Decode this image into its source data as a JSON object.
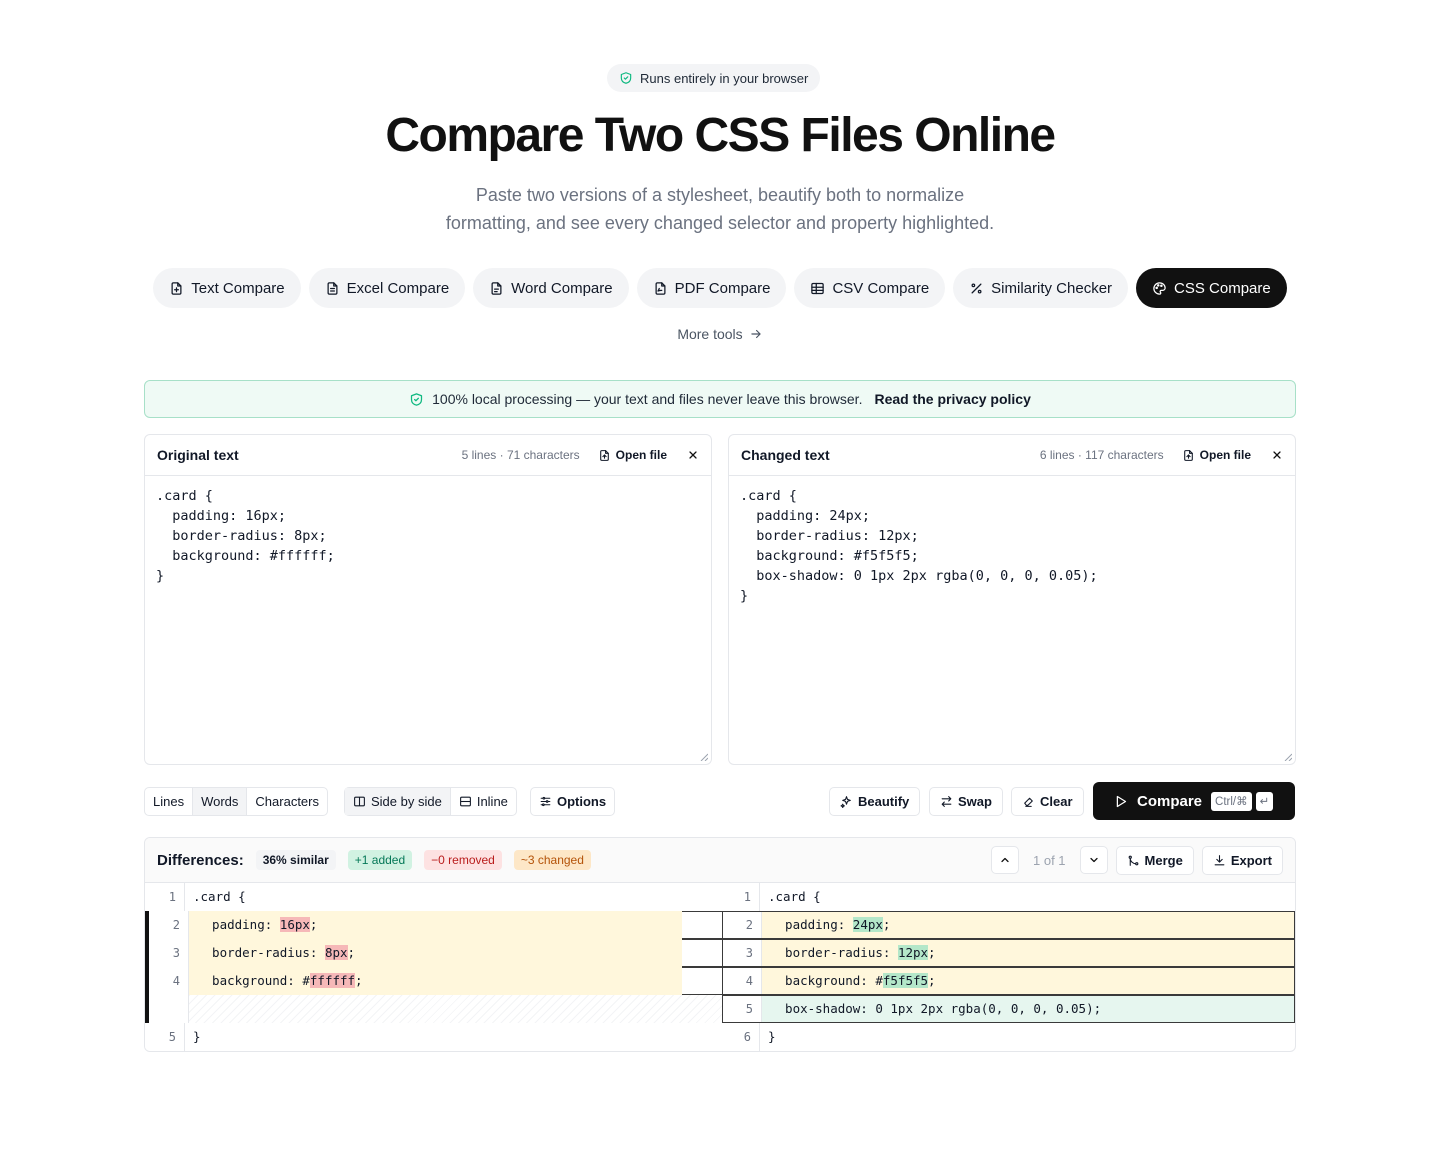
{
  "hero": {
    "badge": "Runs entirely in your browser",
    "title": "Compare Two CSS Files Online",
    "subtitle_line1": "Paste two versions of a stylesheet, beautify both to normalize",
    "subtitle_line2": "formatting, and see every changed selector and property highlighted."
  },
  "tools": [
    {
      "label": "Text Compare",
      "icon": "file-text-icon"
    },
    {
      "label": "Excel Compare",
      "icon": "spreadsheet-file-icon"
    },
    {
      "label": "Word Compare",
      "icon": "document-icon"
    },
    {
      "label": "PDF Compare",
      "icon": "pdf-file-icon"
    },
    {
      "label": "CSV Compare",
      "icon": "table-icon"
    },
    {
      "label": "Similarity Checker",
      "icon": "percent-icon"
    },
    {
      "label": "CSS Compare",
      "icon": "palette-icon",
      "active": true
    }
  ],
  "more_tools": "More tools",
  "privacy": {
    "text": "100% local processing — your text and files never leave this browser.",
    "link": "Read the privacy policy"
  },
  "editors": {
    "left": {
      "title": "Original text",
      "meta": "5 lines · 71 characters",
      "open": "Open file",
      "content": ".card {\n  padding: 16px;\n  border-radius: 8px;\n  background: #ffffff;\n}"
    },
    "right": {
      "title": "Changed text",
      "meta": "6 lines · 117 characters",
      "open": "Open file",
      "content": ".card {\n  padding: 24px;\n  border-radius: 12px;\n  background: #f5f5f5;\n  box-shadow: 0 1px 2px rgba(0, 0, 0, 0.05);\n}"
    }
  },
  "toolbar": {
    "granularity": [
      "Lines",
      "Words",
      "Characters"
    ],
    "view_side": "Side by side",
    "view_inline": "Inline",
    "options": "Options",
    "beautify": "Beautify",
    "swap": "Swap",
    "clear": "Clear",
    "compare": "Compare",
    "kbd_mod": "Ctrl/⌘",
    "kbd_enter": "↵"
  },
  "diff": {
    "title": "Differences:",
    "similar": "36% similar",
    "added": "+1 added",
    "removed": "−0 removed",
    "changed": "~3 changed",
    "counter": "1 of 1",
    "merge": "Merge",
    "export": "Export",
    "rows": [
      {
        "type": "same",
        "l_no": "1",
        "l_pre": ".card {",
        "l_hl": "",
        "l_post": "",
        "r_no": "1",
        "r_pre": ".card {",
        "r_hl": "",
        "r_post": ""
      },
      {
        "type": "changed",
        "l_no": "2",
        "l_pre": "  padding: ",
        "l_hl": "16px",
        "l_post": ";",
        "r_no": "2",
        "r_pre": "  padding: ",
        "r_hl": "24px",
        "r_post": ";"
      },
      {
        "type": "changed",
        "l_no": "3",
        "l_pre": "  border-radius: ",
        "l_hl": "8px",
        "l_post": ";",
        "r_no": "3",
        "r_pre": "  border-radius: ",
        "r_hl": "12px",
        "r_post": ";"
      },
      {
        "type": "changed",
        "l_no": "4",
        "l_pre": "  background: #",
        "l_hl": "ffffff",
        "l_post": ";",
        "r_no": "4",
        "r_pre": "  background: #",
        "r_hl": "f5f5f5",
        "r_post": ";"
      },
      {
        "type": "added",
        "l_no": "",
        "l_pre": "",
        "l_hl": "",
        "l_post": "",
        "r_no": "5",
        "r_pre": "  box-shadow: 0 1px 2px rgba(0, 0, 0, 0.05);",
        "r_hl": "",
        "r_post": ""
      },
      {
        "type": "same",
        "l_no": "5",
        "l_pre": "}",
        "l_hl": "",
        "l_post": "",
        "r_no": "6",
        "r_pre": "}",
        "r_hl": "",
        "r_post": ""
      }
    ]
  },
  "colors": {
    "accent_green": "#10b981",
    "dark": "#111111",
    "changed_bg": "#fff7dc",
    "added_bg": "#e6f6ef",
    "removed_highlight": "#f6b8b8",
    "added_highlight": "#b4e7c9"
  }
}
